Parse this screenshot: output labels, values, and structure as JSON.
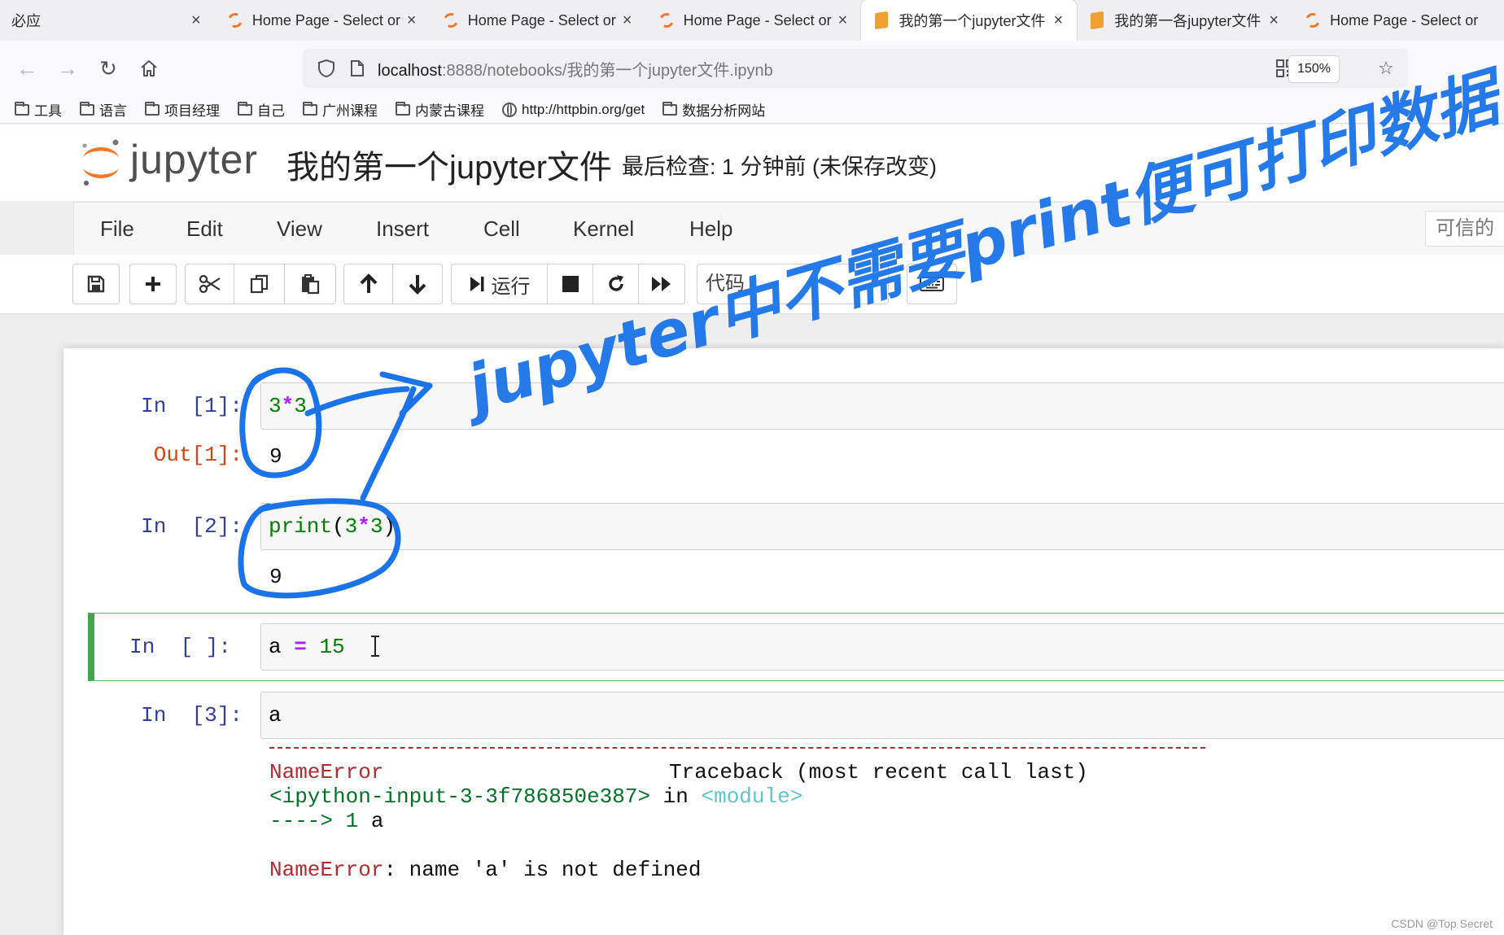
{
  "browser": {
    "tabs": [
      {
        "title": "必应",
        "icon": "none",
        "active": false
      },
      {
        "title": "Home Page - Select or",
        "icon": "jupyter-spinner-icon",
        "active": false
      },
      {
        "title": "Home Page - Select or",
        "icon": "jupyter-spinner-icon",
        "active": false
      },
      {
        "title": "Home Page - Select or",
        "icon": "jupyter-spinner-icon",
        "active": false
      },
      {
        "title": "我的第一个jupyter文件",
        "icon": "notebook-book-icon",
        "active": true
      },
      {
        "title": "我的第一各jupyter文件",
        "icon": "notebook-book-icon",
        "active": false
      },
      {
        "title": "Home Page - Select or",
        "icon": "jupyter-spinner-icon",
        "active": false
      }
    ],
    "close_glyph": "×",
    "url_host": "localhost",
    "url_rest": ":8888/notebooks/我的第一个jupyter文件.ipynb",
    "zoom": "150%",
    "bookmarks": [
      {
        "label": "工具",
        "icon": "folder-icon"
      },
      {
        "label": "语言",
        "icon": "folder-icon"
      },
      {
        "label": "项目经理",
        "icon": "folder-icon"
      },
      {
        "label": "自己",
        "icon": "folder-icon"
      },
      {
        "label": "广州课程",
        "icon": "folder-icon"
      },
      {
        "label": "内蒙古课程",
        "icon": "folder-icon"
      },
      {
        "label": "http://httpbin.org/get",
        "icon": "globe-icon"
      },
      {
        "label": "数据分析网站",
        "icon": "folder-icon"
      }
    ]
  },
  "jupyter": {
    "wordmark": "jupyter",
    "notebook_title": "我的第一个jupyter文件",
    "checkpoint": "最后检查: 1 分钟前  (未保存改变)",
    "trusted_label": "可信的",
    "menu": [
      "File",
      "Edit",
      "View",
      "Insert",
      "Cell",
      "Kernel",
      "Help"
    ],
    "toolbar": {
      "run_label": "运行",
      "cell_type": "代码"
    }
  },
  "cells": {
    "c1": {
      "in_prompt": "In  [1]:",
      "out_prompt": "Out[1]:",
      "code_a": "3",
      "code_op": "*",
      "code_b": "3",
      "output": "9"
    },
    "c2": {
      "in_prompt": "In  [2]:",
      "code_fn": "print",
      "code_open": "(",
      "code_a": "3",
      "code_op": "*",
      "code_b": "3",
      "code_close": ")",
      "output": "9"
    },
    "c3": {
      "in_prompt": "In  [ ]:",
      "code_var": "a",
      "code_op": "=",
      "code_num": "15"
    },
    "c4": {
      "in_prompt": "In  [3]:",
      "code_var": "a"
    }
  },
  "error": {
    "name": "NameError",
    "traceback_header": "Traceback (most recent call last)",
    "input_ref": "<ipython-input-3-3f786850e387>",
    "in_word": " in ",
    "module_ref": "<module>",
    "arrow": "----> 1 ",
    "arrow_code": "a",
    "message_name": "NameError",
    "message_text": ": name 'a' is not defined"
  },
  "annotation": {
    "text_line1": "jupyter中不需要print便可打印数据",
    "color": "#1a73e8"
  },
  "watermark": "CSDN @Top Secret"
}
